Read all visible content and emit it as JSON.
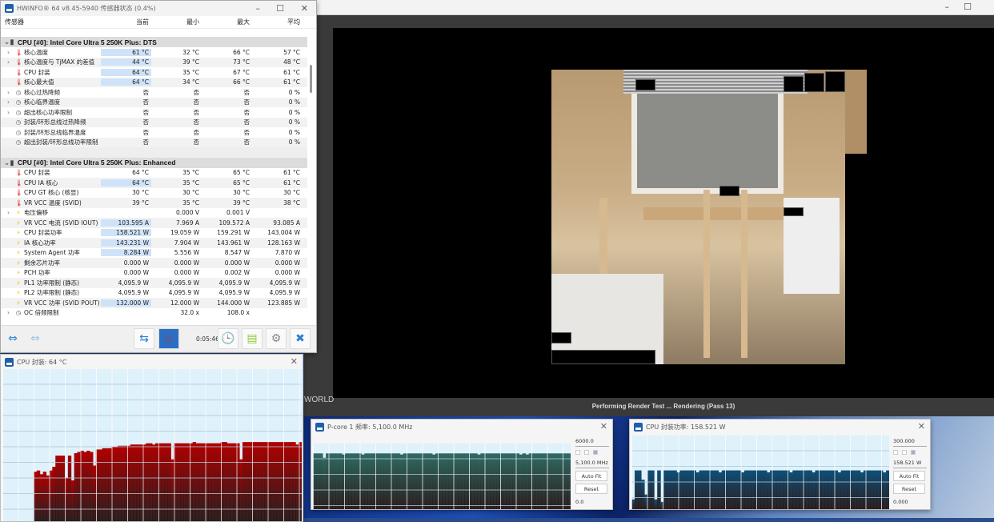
{
  "render_app": {
    "status": "Performing Render Test ... Rendering (Pass 13)",
    "side_label": "WORLD"
  },
  "hwinfo": {
    "title": "HWiNFO® 64 v8.45-5940 传感器状态 (0.4%)",
    "columns": [
      "传感器",
      "当前",
      "最小",
      "最大",
      "平均"
    ],
    "sections": [
      {
        "title": "CPU [#0]: Intel Core Ultra 5 250K Plus: DTS",
        "rows": [
          {
            "label": "核心温度",
            "icon": "thermometer",
            "expand": true,
            "hl": true,
            "v": [
              "61 °C",
              "32 °C",
              "66 °C",
              "57 °C"
            ]
          },
          {
            "label": "核心温度与 TjMAX 的差值",
            "icon": "thermometer",
            "expand": true,
            "hl": true,
            "v": [
              "44 °C",
              "39 °C",
              "73 °C",
              "48 °C"
            ]
          },
          {
            "label": "CPU 封装",
            "icon": "thermometer",
            "expand": false,
            "hl": true,
            "v": [
              "64 °C",
              "35 °C",
              "67 °C",
              "61 °C"
            ]
          },
          {
            "label": "核心最大值",
            "icon": "thermometer",
            "expand": false,
            "hl": true,
            "v": [
              "64 °C",
              "34 °C",
              "66 °C",
              "61 °C"
            ]
          },
          {
            "label": "核心过热降频",
            "icon": "clock",
            "expand": true,
            "hl": false,
            "v": [
              "否",
              "否",
              "否",
              "0 %"
            ]
          },
          {
            "label": "核心临界温度",
            "icon": "clock",
            "expand": true,
            "hl": false,
            "v": [
              "否",
              "否",
              "否",
              "0 %"
            ]
          },
          {
            "label": "超出核心功率限制",
            "icon": "clock",
            "expand": true,
            "hl": false,
            "v": [
              "否",
              "否",
              "否",
              "0 %"
            ]
          },
          {
            "label": "封装/环形总线过热降频",
            "icon": "clock",
            "expand": false,
            "hl": false,
            "v": [
              "否",
              "否",
              "否",
              "0 %"
            ]
          },
          {
            "label": "封装/环形总线临界温度",
            "icon": "clock",
            "expand": false,
            "hl": false,
            "v": [
              "否",
              "否",
              "否",
              "0 %"
            ]
          },
          {
            "label": "超出封装/环形总线功率限制",
            "icon": "clock",
            "expand": false,
            "hl": false,
            "v": [
              "否",
              "否",
              "否",
              "0 %"
            ]
          }
        ]
      },
      {
        "title": "CPU [#0]: Intel Core Ultra 5 250K Plus: Enhanced",
        "rows": [
          {
            "label": "CPU 封装",
            "icon": "thermometer",
            "expand": false,
            "hl": false,
            "v": [
              "64 °C",
              "35 °C",
              "65 °C",
              "61 °C"
            ]
          },
          {
            "label": "CPU IA 核心",
            "icon": "thermometer",
            "expand": false,
            "hl": true,
            "v": [
              "64 °C",
              "35 °C",
              "65 °C",
              "61 °C"
            ]
          },
          {
            "label": "CPU GT 核心 (核显)",
            "icon": "thermometer",
            "expand": false,
            "hl": false,
            "v": [
              "30 °C",
              "30 °C",
              "30 °C",
              "30 °C"
            ]
          },
          {
            "label": "VR VCC 温度 (SVID)",
            "icon": "thermometer",
            "expand": false,
            "hl": false,
            "v": [
              "39 °C",
              "35 °C",
              "39 °C",
              "38 °C"
            ]
          },
          {
            "label": "电压偏移",
            "icon": "bolt",
            "expand": true,
            "hl": false,
            "v": [
              "",
              "0.000 V",
              "0.001 V",
              ""
            ]
          },
          {
            "label": "VR VCC 电流 (SVID IOUT)",
            "icon": "bolt",
            "expand": false,
            "hl": true,
            "v": [
              "103.595 A",
              "7.969 A",
              "109.572 A",
              "93.085 A"
            ]
          },
          {
            "label": "CPU 封装功率",
            "icon": "bolt",
            "expand": false,
            "hl": true,
            "v": [
              "158.521 W",
              "19.059 W",
              "159.291 W",
              "143.004 W"
            ]
          },
          {
            "label": "IA 核心功率",
            "icon": "bolt",
            "expand": false,
            "hl": true,
            "v": [
              "143.231 W",
              "7.904 W",
              "143.961 W",
              "128.163 W"
            ]
          },
          {
            "label": "System Agent 功率",
            "icon": "bolt",
            "expand": false,
            "hl": true,
            "v": [
              "8.284 W",
              "5.556 W",
              "8.547 W",
              "7.870 W"
            ]
          },
          {
            "label": "剩余芯片功率",
            "icon": "bolt",
            "expand": false,
            "hl": false,
            "v": [
              "0.000 W",
              "0.000 W",
              "0.000 W",
              "0.000 W"
            ]
          },
          {
            "label": "PCH 功率",
            "icon": "bolt",
            "expand": false,
            "hl": false,
            "v": [
              "0.000 W",
              "0.000 W",
              "0.002 W",
              "0.000 W"
            ]
          },
          {
            "label": "PL1 功率限制 (静态)",
            "icon": "bolt",
            "expand": false,
            "hl": false,
            "v": [
              "4,095.9 W",
              "4,095.9 W",
              "4,095.9 W",
              "4,095.9 W"
            ]
          },
          {
            "label": "PL2 功率限制 (静态)",
            "icon": "bolt",
            "expand": false,
            "hl": false,
            "v": [
              "4,095.9 W",
              "4,095.9 W",
              "4,095.9 W",
              "4,095.9 W"
            ]
          },
          {
            "label": "VR VCC 功率 (SVID POUT)",
            "icon": "bolt",
            "expand": false,
            "hl": true,
            "v": [
              "132.000 W",
              "12.000 W",
              "144.000 W",
              "123.885 W"
            ]
          },
          {
            "label": "OC 倍频限制",
            "icon": "clock",
            "expand": true,
            "hl": false,
            "v": [
              "",
              "32.0 x",
              "108.0 x",
              ""
            ]
          }
        ]
      }
    ],
    "toolbar": {
      "timer": "0:05:46"
    }
  },
  "graphs": [
    {
      "title": "CPU 封装: 64 °C",
      "color": "#b00000",
      "max": 123,
      "values": [
        0,
        0,
        0,
        0,
        0,
        0,
        0,
        0,
        0,
        0,
        40,
        41,
        38,
        40,
        37,
        41,
        44,
        53,
        53,
        53,
        35,
        53,
        33,
        55,
        56,
        57,
        56,
        57,
        56,
        45,
        58,
        58,
        59,
        59,
        59,
        60,
        60,
        61,
        61,
        61,
        61,
        62,
        62,
        62,
        62,
        62,
        63,
        63,
        62,
        63,
        63,
        63,
        63,
        63,
        50,
        63,
        63,
        63,
        63,
        63,
        63,
        64,
        63,
        63,
        63,
        63,
        63,
        63,
        63,
        63,
        64,
        64,
        63,
        63,
        63,
        63,
        50,
        64,
        64,
        64,
        64,
        64,
        64,
        64,
        64,
        64,
        64,
        64,
        64,
        64,
        64,
        64,
        64,
        64,
        62,
        64
      ]
    },
    {
      "title": "P-core 1 频率: 5,100.0 MHz",
      "color": "#2f6b63",
      "max_label": "6000.0",
      "current": "5,100.0 MHz",
      "min_label": "0.0",
      "max": 6000,
      "values": [
        5100,
        5100,
        5100,
        4700,
        5100,
        5100,
        5100,
        5100,
        5100,
        5000,
        5100,
        5100,
        5100,
        5100,
        5100,
        5000,
        5100,
        5100,
        5100,
        5100,
        5100,
        5100,
        5100,
        5100,
        5100,
        5100,
        5100,
        5000,
        5100,
        5100,
        5100,
        5100,
        5100,
        5100,
        5100,
        5100,
        5100,
        5000,
        5100,
        5100,
        5100,
        5100,
        5100,
        5100,
        5100,
        5100,
        5100,
        5100,
        5100,
        5100,
        5100,
        5000,
        5100,
        5100,
        5100,
        5100,
        5100,
        5100,
        5100,
        5100,
        5100,
        5100,
        5100,
        5100,
        5000,
        5100,
        5000,
        5100,
        5100,
        5100,
        5100,
        5100,
        5100,
        5100,
        5100,
        5100,
        5100,
        5100,
        5100,
        5100
      ]
    },
    {
      "title": "CPU 封装功率: 158.521 W",
      "color": "#0f4f78",
      "max_label": "300.000",
      "current": "158.521 W",
      "min_label": "0.000",
      "max": 300,
      "values": [
        40,
        158,
        158,
        120,
        60,
        158,
        158,
        40,
        158,
        30,
        158,
        158,
        158,
        158,
        150,
        158,
        158,
        158,
        158,
        158,
        150,
        158,
        158,
        158,
        158,
        158,
        158,
        150,
        158,
        158,
        158,
        158,
        158,
        158,
        150,
        158,
        158,
        158,
        158,
        158,
        158,
        158,
        150,
        158,
        158,
        158,
        158,
        158,
        158,
        150,
        158,
        158,
        158,
        158,
        158,
        158,
        150,
        158,
        158,
        158,
        158,
        158,
        158,
        158,
        150,
        158,
        158,
        158,
        158,
        158,
        158,
        150,
        158,
        158,
        158,
        158,
        158,
        158,
        150,
        158
      ]
    }
  ]
}
